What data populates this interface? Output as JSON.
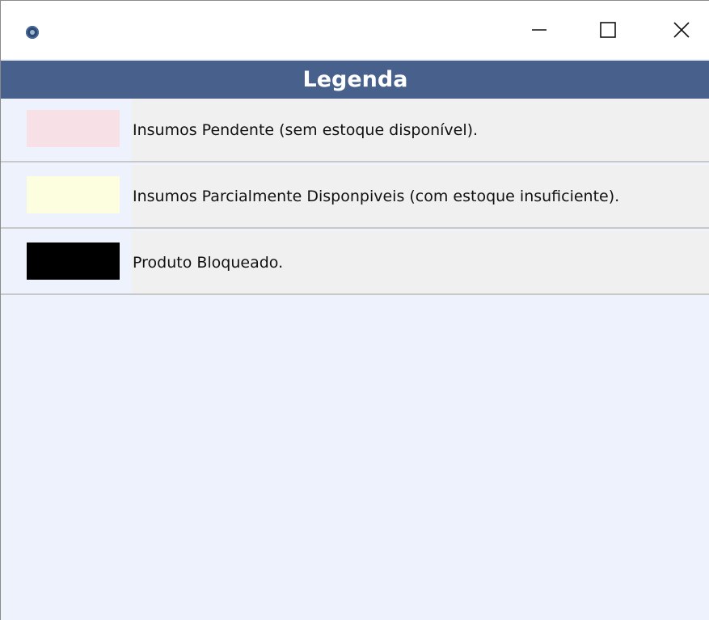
{
  "window": {
    "controls": {
      "minimize": "minimize",
      "maximize": "maximize",
      "close": "close"
    }
  },
  "header": {
    "title": "Legenda"
  },
  "legend": [
    {
      "color": "#f7e1e6",
      "label": "Insumos Pendente (sem estoque disponível)."
    },
    {
      "color": "#fdfde0",
      "label": "Insumos Parcialmente Disponpiveis (com estoque insuficiente)."
    },
    {
      "color": "#000000",
      "label": "Produto Bloqueado."
    }
  ],
  "icons": {
    "app": "app-icon",
    "minimize": "minimize-icon",
    "maximize": "maximize-icon",
    "close": "close-icon"
  }
}
